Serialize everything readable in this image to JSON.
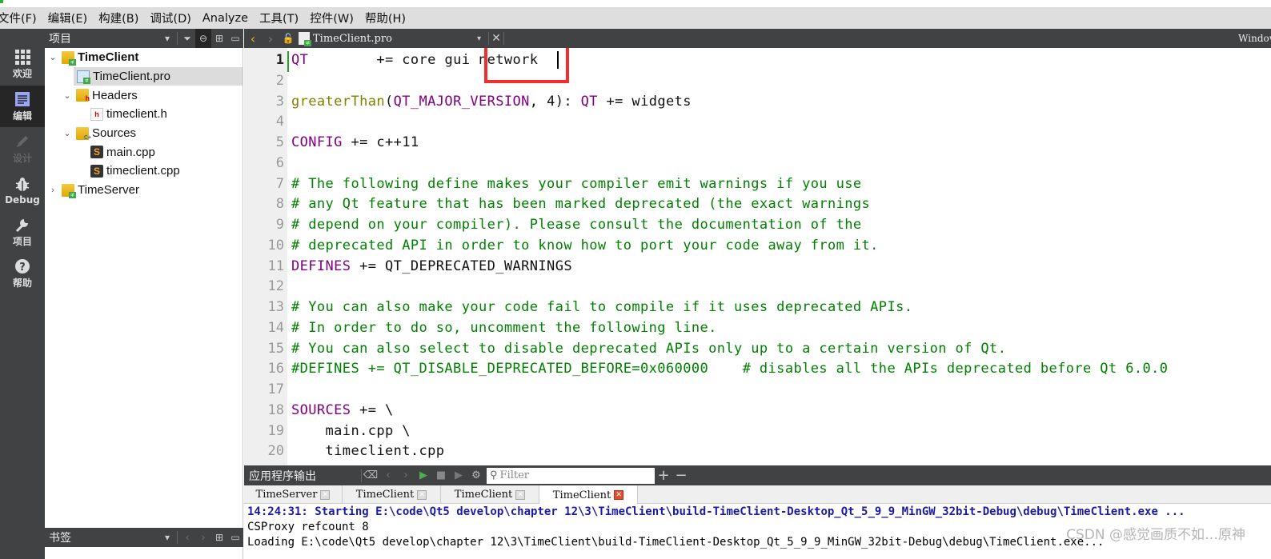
{
  "menubar": {
    "items": [
      "文件(F)",
      "编辑(E)",
      "构建(B)",
      "调试(D)",
      "Analyze",
      "工具(T)",
      "控件(W)",
      "帮助(H)"
    ]
  },
  "modes": [
    {
      "label": "欢迎",
      "icon": "grid-icon",
      "state": "normal"
    },
    {
      "label": "编辑",
      "icon": "edit-document-icon",
      "state": "active"
    },
    {
      "label": "设计",
      "icon": "pencil-icon",
      "state": "disabled"
    },
    {
      "label": "Debug",
      "icon": "bug-icon",
      "state": "normal"
    },
    {
      "label": "项目",
      "icon": "wrench-icon",
      "state": "normal"
    },
    {
      "label": "帮助",
      "icon": "help-icon",
      "state": "normal"
    }
  ],
  "project_pane": {
    "title": "项目",
    "tree": [
      {
        "label": "TimeClient",
        "level": 0,
        "expanded": true,
        "bold": true,
        "icon": "qt-project-folder-icon"
      },
      {
        "label": "TimeClient.pro",
        "level": 1,
        "selected": true,
        "icon": "pro-file-icon"
      },
      {
        "label": "Headers",
        "level": 1,
        "expanded": true,
        "icon": "headers-folder-icon"
      },
      {
        "label": "timeclient.h",
        "level": 2,
        "icon": "header-file-icon"
      },
      {
        "label": "Sources",
        "level": 1,
        "expanded": true,
        "icon": "sources-folder-icon"
      },
      {
        "label": "main.cpp",
        "level": 2,
        "icon": "cpp-file-icon"
      },
      {
        "label": "timeclient.cpp",
        "level": 2,
        "icon": "cpp-file-icon"
      },
      {
        "label": "TimeServer",
        "level": 0,
        "expanded": false,
        "icon": "qt-project-folder-icon"
      }
    ]
  },
  "bookmarks_pane": {
    "title": "书签"
  },
  "editor": {
    "open_file": "TimeClient.pro",
    "right_label": "Window",
    "current_line": 1,
    "highlight_note": "network",
    "lines": [
      {
        "n": "1",
        "parts": [
          {
            "t": "QT",
            "c": "kw"
          },
          {
            "t": "        += core gui network",
            "c": ""
          }
        ]
      },
      {
        "n": "2",
        "parts": []
      },
      {
        "n": "3",
        "parts": [
          {
            "t": "greaterThan",
            "c": "fn"
          },
          {
            "t": "(",
            "c": ""
          },
          {
            "t": "QT_MAJOR_VERSION",
            "c": "kw"
          },
          {
            "t": ", 4): ",
            "c": ""
          },
          {
            "t": "QT",
            "c": "kw"
          },
          {
            "t": " += widgets",
            "c": ""
          }
        ]
      },
      {
        "n": "4",
        "parts": []
      },
      {
        "n": "5",
        "parts": [
          {
            "t": "CONFIG",
            "c": "kw"
          },
          {
            "t": " += c++11",
            "c": ""
          }
        ]
      },
      {
        "n": "6",
        "parts": []
      },
      {
        "n": "7",
        "parts": [
          {
            "t": "# The following define makes your compiler emit warnings if you use",
            "c": "cm"
          }
        ]
      },
      {
        "n": "8",
        "parts": [
          {
            "t": "# any Qt feature that has been marked deprecated (the exact warnings",
            "c": "cm"
          }
        ]
      },
      {
        "n": "9",
        "parts": [
          {
            "t": "# depend on your compiler). Please consult the documentation of the",
            "c": "cm"
          }
        ]
      },
      {
        "n": "10",
        "parts": [
          {
            "t": "# deprecated API in order to know how to port your code away from it.",
            "c": "cm"
          }
        ]
      },
      {
        "n": "11",
        "parts": [
          {
            "t": "DEFINES",
            "c": "kw"
          },
          {
            "t": " += QT_DEPRECATED_WARNINGS",
            "c": ""
          }
        ]
      },
      {
        "n": "12",
        "parts": []
      },
      {
        "n": "13",
        "parts": [
          {
            "t": "# You can also make your code fail to compile if it uses deprecated APIs.",
            "c": "cm"
          }
        ]
      },
      {
        "n": "14",
        "parts": [
          {
            "t": "# In order to do so, uncomment the following line.",
            "c": "cm"
          }
        ]
      },
      {
        "n": "15",
        "parts": [
          {
            "t": "# You can also select to disable deprecated APIs only up to a certain version of Qt.",
            "c": "cm"
          }
        ]
      },
      {
        "n": "16",
        "parts": [
          {
            "t": "#DEFINES += QT_DISABLE_DEPRECATED_BEFORE=0x060000    # disables all the APIs deprecated before Qt 6.0.0",
            "c": "cm"
          }
        ]
      },
      {
        "n": "17",
        "parts": []
      },
      {
        "n": "18",
        "parts": [
          {
            "t": "SOURCES",
            "c": "kw"
          },
          {
            "t": " += \\",
            "c": ""
          }
        ]
      },
      {
        "n": "19",
        "parts": [
          {
            "t": "    main.cpp \\",
            "c": ""
          }
        ]
      },
      {
        "n": "20",
        "parts": [
          {
            "t": "    timeclient.cpp",
            "c": ""
          }
        ]
      }
    ]
  },
  "output_pane": {
    "title": "应用程序输出",
    "filter_placeholder": "Filter",
    "tabs": [
      {
        "label": "TimeServer",
        "active": false
      },
      {
        "label": "TimeClient",
        "active": false
      },
      {
        "label": "TimeClient",
        "active": false
      },
      {
        "label": "TimeClient",
        "active": true
      }
    ],
    "lines": [
      "14:24:31: Starting E:\\code\\Qt5 develop\\chapter 12\\3\\TimeClient\\build-TimeClient-Desktop_Qt_5_9_9_MinGW_32bit-Debug\\debug\\TimeClient.exe ...",
      "CSProxy refcount 8",
      "Loading E:\\code\\Qt5 develop\\chapter 12\\3\\TimeClient\\build-TimeClient-Desktop_Qt_5_9_9_MinGW_32bit-Debug\\debug\\TimeClient.exe..."
    ]
  },
  "watermark": "CSDN @感觉画质不如…原神"
}
